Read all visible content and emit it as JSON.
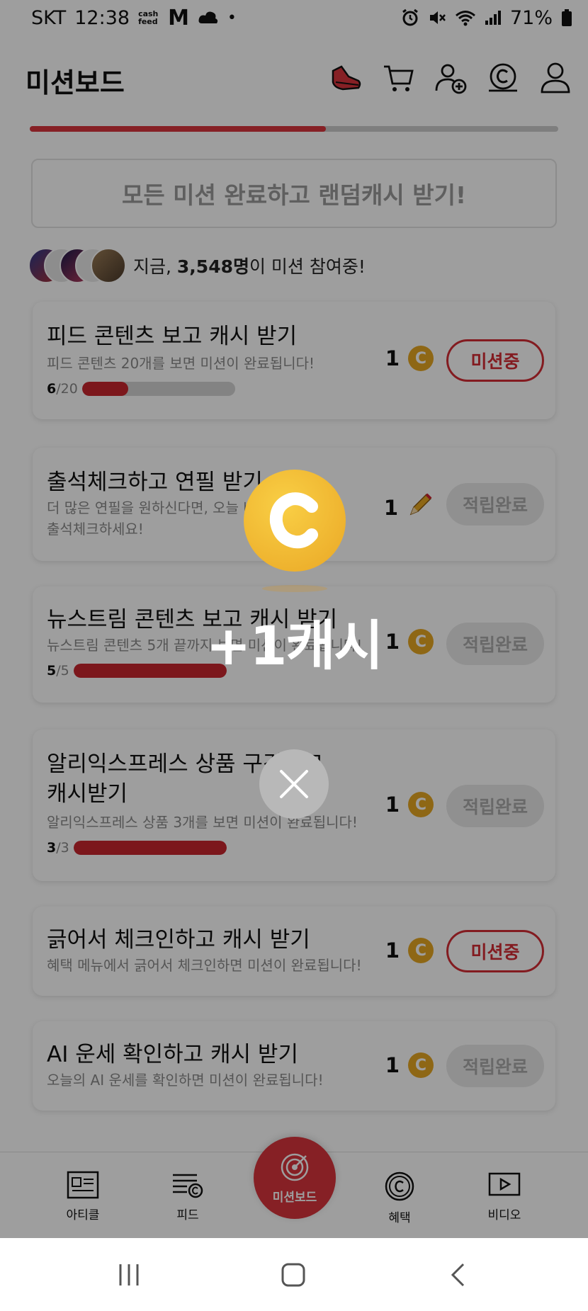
{
  "status_bar": {
    "carrier": "SKT",
    "time": "12:38",
    "notif_cashfeed": "cash feed",
    "notif_m": "M",
    "dot": "•",
    "battery": "71%"
  },
  "header": {
    "title": "미션보드",
    "icons": [
      "sneaker-icon",
      "cart-icon",
      "add-friend-icon",
      "cash-coin-icon",
      "profile-icon"
    ]
  },
  "progress": {
    "fraction": 0.56,
    "accent": "#d8353d"
  },
  "all_mission_banner": "모든 미션 완료하고 랜덤캐시 받기!",
  "participants": {
    "prefix": "지금, ",
    "count": "3,548명",
    "suffix": "이 미션 참여중!"
  },
  "missions": [
    {
      "title": "피드 콘텐츠 보고 캐시 받기",
      "desc": "피드 콘텐츠 20개를 보면 미션이 완료됩니다!",
      "progress_done": "6",
      "progress_total": "/20",
      "progress_fraction": 0.3,
      "reward": "1",
      "reward_type": "coin",
      "button": "미션중",
      "status": "active"
    },
    {
      "title": "출석체크하고 연필 받기",
      "desc": "더 많은 연필을 원하신다면, 오늘 바로 출석체크하세요!",
      "reward": "1",
      "reward_type": "pencil",
      "button": "적립완료",
      "status": "done"
    },
    {
      "title": "뉴스트림 콘텐츠 보고 캐시 받기",
      "desc": "뉴스트림 콘텐츠 5개 끝까지 보면 미션이 완료됩니다!",
      "progress_done": "5",
      "progress_total": "/5",
      "progress_fraction": 1.0,
      "reward": "1",
      "reward_type": "coin",
      "button": "적립완료",
      "status": "done"
    },
    {
      "title": "알리익스프레스 상품 구경하고 캐시받기",
      "desc": "알리익스프레스 상품 3개를 보면 미션이 완료됩니다!",
      "progress_done": "3",
      "progress_total": "/3",
      "progress_fraction": 1.0,
      "reward": "1",
      "reward_type": "coin",
      "button": "적립완료",
      "status": "done"
    },
    {
      "title": "긁어서 체크인하고 캐시 받기",
      "desc": "혜택 메뉴에서 긁어서 체크인하면 미션이 완료됩니다!",
      "reward": "1",
      "reward_type": "coin",
      "button": "미션중",
      "status": "active"
    },
    {
      "title": "AI 운세 확인하고 캐시 받기",
      "desc": "오늘의 AI 운세를 확인하면 미션이 완료됩니다!",
      "reward": "1",
      "reward_type": "coin",
      "button": "적립완료",
      "status": "done"
    }
  ],
  "bottom_nav": {
    "article": "아티클",
    "feed": "피드",
    "missionboard": "미션보드",
    "benefit": "혜택",
    "video": "비디오"
  },
  "popup": {
    "reward_text": "+1캐시",
    "coin_icon": "cash-coin-icon",
    "close_icon": "close-icon"
  }
}
